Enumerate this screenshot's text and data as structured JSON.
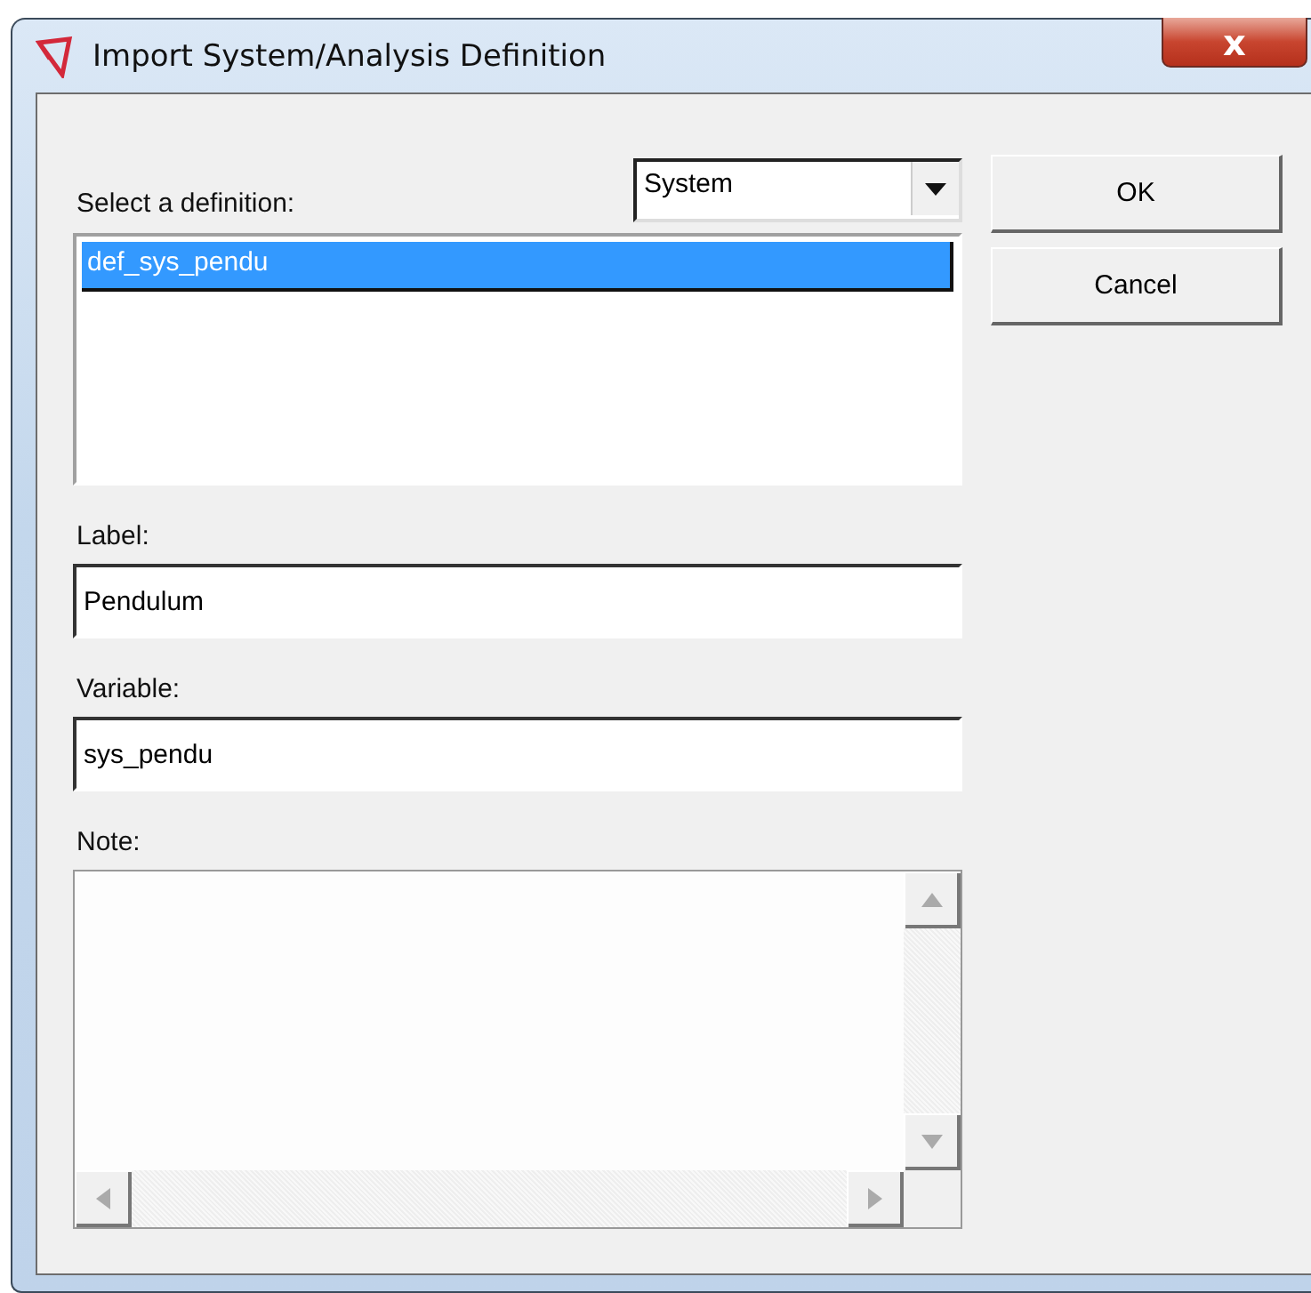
{
  "window": {
    "title": "Import System/Analysis Definition",
    "close": "x"
  },
  "definition": {
    "label": "Select a definition:",
    "type_dropdown": "System"
  },
  "definitions": [
    {
      "name": "def_sys_pendu",
      "selected": true
    }
  ],
  "fields": [
    {
      "label": "Label:",
      "value": "Pendulum"
    },
    {
      "label": "Variable:",
      "value": "sys_pendu"
    }
  ],
  "note": {
    "label": "Note:"
  },
  "buttons": [
    "OK",
    "Cancel"
  ]
}
